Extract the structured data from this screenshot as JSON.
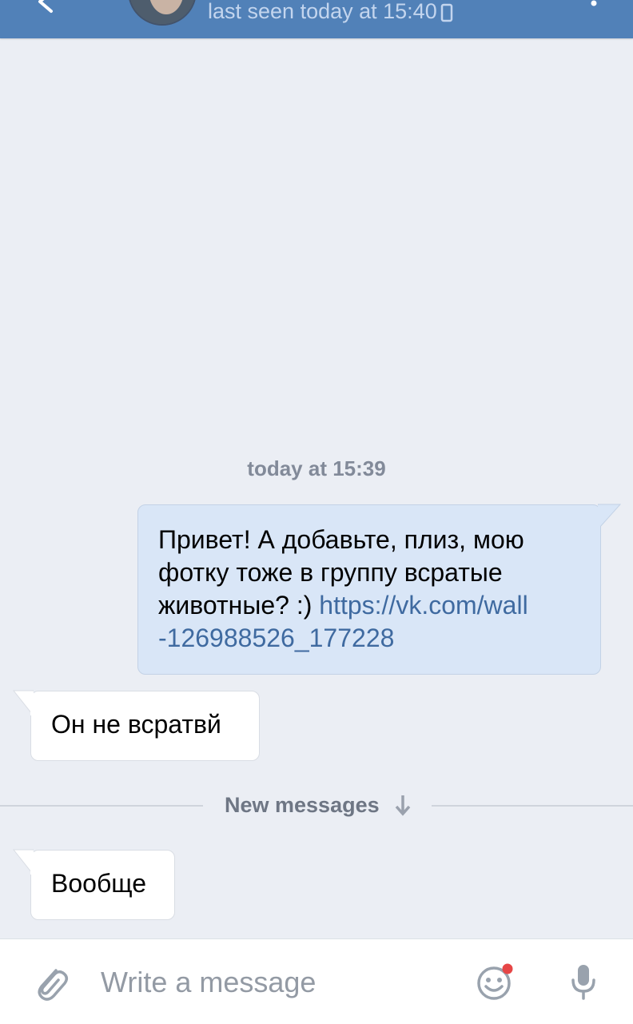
{
  "header": {
    "status": "last seen today at 15:40",
    "accent_color": "#5181b8",
    "status_icon": "phone-icon"
  },
  "conversation": {
    "timestamp": "today at 15:39",
    "outgoing": {
      "text": "Привет! А добавьте, плиз, мою фотку тоже в группу всратые животные? :) ",
      "link": "https://vk.com/wall-126988526_177228",
      "link_display_line1": "https://vk.com/wall",
      "link_display_line2": "-126988526_177228"
    },
    "incoming_1": {
      "text": "Он не всратвй"
    },
    "new_messages_label": "New messages",
    "incoming_2": {
      "text": "Вообще"
    }
  },
  "composer": {
    "placeholder": "Write a message",
    "emoji_badge_color": "#e64646",
    "icons": [
      "attach-icon",
      "emoji-icon",
      "mic-icon"
    ]
  }
}
